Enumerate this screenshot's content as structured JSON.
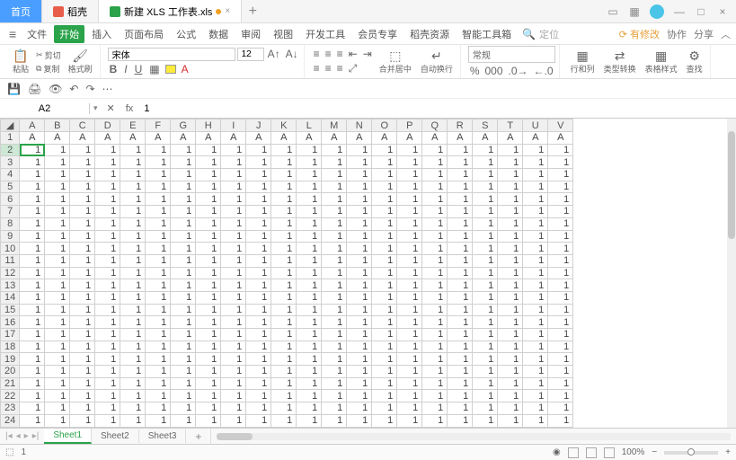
{
  "titlebar": {
    "tabs": [
      {
        "label": "首页",
        "active": true
      },
      {
        "label": "稻壳",
        "icon": "doc"
      },
      {
        "label": "新建 XLS 工作表.xls",
        "icon": "sheet",
        "modified": true
      }
    ]
  },
  "menubar": {
    "file": "文件",
    "items": [
      "开始",
      "插入",
      "页面布局",
      "公式",
      "数据",
      "审阅",
      "视图",
      "开发工具",
      "会员专享",
      "稻壳资源",
      "智能工具箱"
    ],
    "active_index": 0,
    "search_placeholder": "定位",
    "right": {
      "sync": "有修改",
      "coop": "协作",
      "share": "分享"
    }
  },
  "ribbon": {
    "paste": "粘贴",
    "cut": "剪切",
    "copy": "复制",
    "format_painter": "格式刷",
    "font_name": "宋体",
    "font_size": "12",
    "merge": "合并居中",
    "wrap": "自动换行",
    "general": "常规",
    "row_col": "行和列",
    "cond_fmt": "类型转换",
    "table_style": "表格样式",
    "find": "查找"
  },
  "cellref": {
    "name": "A2",
    "formula": "1"
  },
  "sheet": {
    "columns": [
      "A",
      "B",
      "C",
      "D",
      "E",
      "F",
      "G",
      "H",
      "I",
      "J",
      "K",
      "L",
      "M",
      "N",
      "O",
      "P",
      "Q",
      "R",
      "S",
      "T",
      "U",
      "V"
    ],
    "row1_value": "A",
    "data_value": "1",
    "row_count": 24,
    "selected": {
      "row": 2,
      "col": "A"
    },
    "tabs": [
      "Sheet1",
      "Sheet2",
      "Sheet3"
    ],
    "active_tab": 0
  },
  "status": {
    "ready": "1",
    "zoom": "100%"
  },
  "chart_data": {
    "type": "table",
    "columns": [
      "A",
      "B",
      "C",
      "D",
      "E",
      "F",
      "G",
      "H",
      "I",
      "J",
      "K",
      "L",
      "M",
      "N",
      "O",
      "P",
      "Q",
      "R",
      "S",
      "T",
      "U",
      "V"
    ],
    "header_row": [
      "A",
      "A",
      "A",
      "A",
      "A",
      "A",
      "A",
      "A",
      "A",
      "A",
      "A",
      "A",
      "A",
      "A",
      "A",
      "A",
      "A",
      "A",
      "A",
      "A",
      "A",
      "A"
    ],
    "data_rows": 23,
    "all_cells_value": 1
  }
}
